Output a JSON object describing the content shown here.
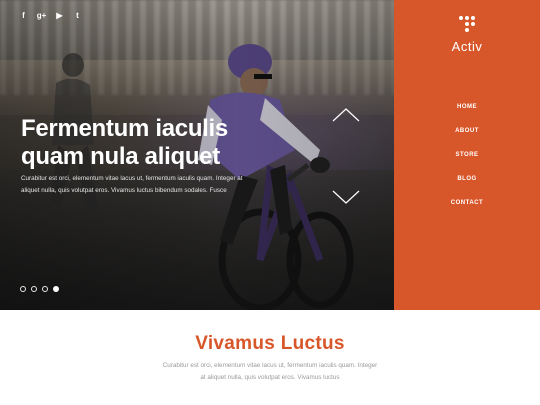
{
  "social": {
    "facebook": "f",
    "googleplus": "g+",
    "youtube": "▶",
    "twitter": "t"
  },
  "hero": {
    "title_line1": "Fermentum iaculis",
    "title_line2": "quam nula aliquet",
    "text": "Curabitur est orci, elementum vitae lacus ut, fermentum iaculis quam. Integer at aliquet nulla, quis volutpat eros. Vivamus luctus bibendum sodales. Fusce",
    "slides": 4,
    "active_slide": 4
  },
  "sidebar": {
    "brand": "Activ",
    "accent_color": "#d8572a",
    "nav": [
      "HOME",
      "ABOUT",
      "STORE",
      "BLOG",
      "CONTACT"
    ]
  },
  "section": {
    "title": "Vivamus Luctus",
    "text": "Curabitur est orci, elementum vitae lacus ut, fermentum iaculis quam. Integer at aliquet nulla, quis volutpat eros. Vivamus luctus"
  }
}
